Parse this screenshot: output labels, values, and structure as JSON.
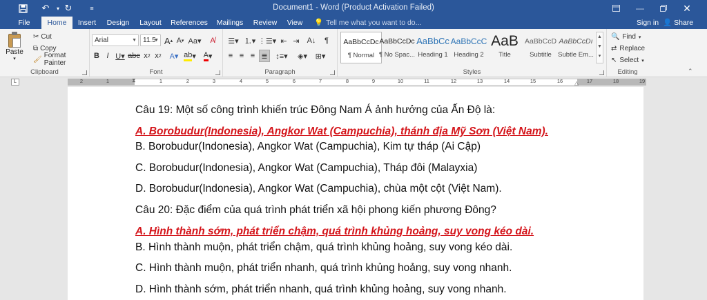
{
  "window": {
    "title": "Document1 - Word (Product Activation Failed)"
  },
  "tabs": [
    "File",
    "Home",
    "Insert",
    "Design",
    "Layout",
    "References",
    "Mailings",
    "Review",
    "View"
  ],
  "tell_me": "Tell me what you want to do...",
  "account": {
    "sign_in": "Sign in",
    "share": "Share"
  },
  "ribbon": {
    "clipboard": {
      "label": "Clipboard",
      "paste": "Paste",
      "cut": "Cut",
      "copy": "Copy",
      "format_painter": "Format Painter"
    },
    "font": {
      "label": "Font",
      "family": "Arial",
      "size": "11.5"
    },
    "paragraph": {
      "label": "Paragraph"
    },
    "styles": {
      "label": "Styles",
      "items": [
        {
          "preview": "AaBbCcDc",
          "name": "¶ Normal"
        },
        {
          "preview": "AaBbCcDc",
          "name": "¶ No Spac..."
        },
        {
          "preview": "AaBbCc",
          "name": "Heading 1"
        },
        {
          "preview": "AaBbCcC",
          "name": "Heading 2"
        },
        {
          "preview": "AaB",
          "name": "Title"
        },
        {
          "preview": "AaBbCcD",
          "name": "Subtitle"
        },
        {
          "preview": "AaBbCcDı",
          "name": "Subtle Em..."
        }
      ]
    },
    "editing": {
      "label": "Editing",
      "find": "Find",
      "replace": "Replace",
      "select": "Select"
    }
  },
  "ruler": {
    "numbers": [
      "2",
      "1",
      "1",
      "2",
      "3",
      "4",
      "5",
      "6",
      "7",
      "8",
      "9",
      "10",
      "11",
      "12",
      "13",
      "14",
      "15",
      "16",
      "17",
      "18",
      "19"
    ]
  },
  "document": {
    "paragraphs": [
      {
        "text": "Câu 19: Một số công trình khiến trúc Đông Nam Á ảnh hưởng của Ấn Độ là:",
        "answer": false
      },
      {
        "text": "A. Borobudur(Indonesia), Angkor Wat (Campuchia), thánh địa Mỹ Sơn (Việt Nam).",
        "answer": true
      },
      {
        "text": "B. Borobudur(Indonesia), Angkor Wat (Campuchia), Kim tự tháp (Ai Cập)",
        "answer": false
      },
      {
        "text": "C. Borobudur(Indonesia), Angkor Wat (Campuchia), Tháp đôi (Malayxia)",
        "answer": false
      },
      {
        "text": "D. Borobudur(Indonesia), Angkor Wat (Campuchia), chùa một cột (Việt Nam).",
        "answer": false
      },
      {
        "text": "Câu 20: Đặc điểm của quá trình phát triển xã hội phong kiến phương Đông?",
        "answer": false
      },
      {
        "text": "A. Hình thành sớm, phát triển chậm, quá trình khủng hoảng, suy vong kéo dài.",
        "answer": true
      },
      {
        "text": "B. Hình thành muộn, phát triển chậm, quá trình khủng hoảng, suy vong kéo dài.",
        "answer": false
      },
      {
        "text": "C. Hình thành muộn, phát triển nhanh, quá trình khủng hoảng, suy vong nhanh.",
        "answer": false
      },
      {
        "text": "D. Hình thành sớm, phát triển nhanh, quá trình khủng hoảng, suy vong nhanh.",
        "answer": false
      }
    ]
  },
  "colors": {
    "accent": "#2b579a",
    "answer": "#d4141a"
  }
}
